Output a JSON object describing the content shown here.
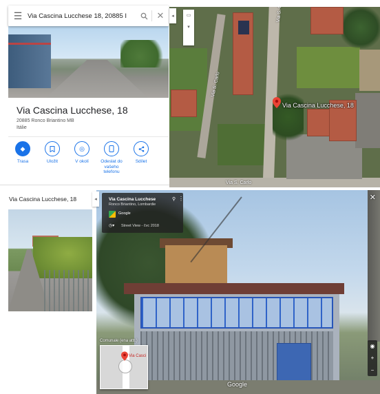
{
  "search": {
    "query": "Via Cascina Lucchese 18, 20885 I",
    "menu_icon": "menu-icon",
    "search_icon": "search-icon",
    "clear_icon": "close-icon"
  },
  "place": {
    "title": "Via Cascina Lucchese, 18",
    "address_line": "20885 Ronco Briantino MB",
    "country": "Itálie"
  },
  "actions": [
    {
      "label": "Trasa",
      "icon": "directions-icon"
    },
    {
      "label": "Uložit",
      "icon": "bookmark-icon"
    },
    {
      "label": "V okolí",
      "icon": "nearby-icon"
    },
    {
      "label": "Odeslat do vašeho telefonu",
      "label_lines": [
        "Odeslat do",
        "vašeho",
        "telefonu"
      ],
      "icon": "send-to-phone-icon"
    },
    {
      "label": "Sdílet",
      "icon": "share-icon"
    }
  ],
  "map": {
    "pin_label": "Via Cascina Lucchese, 18",
    "road_labels": [
      "Via S. Carlo",
      "Via S. Carlo",
      "Via S. Carlo"
    ],
    "colors": {
      "pin": "#ea4335"
    }
  },
  "bottom_panel": {
    "title": "Via Cascina Lucchese, 18"
  },
  "street_view": {
    "card_title": "Via Cascina Lucchese",
    "card_subtitle": "Ronco Briantino, Lombardie",
    "provider": "Google",
    "history_text": "Street View - čvc 2018",
    "minimap_label": "Via Casci",
    "overlay_label": "Comunale (ena attr.)",
    "watermark": "Google"
  },
  "colors": {
    "accent": "#1a73e8"
  }
}
